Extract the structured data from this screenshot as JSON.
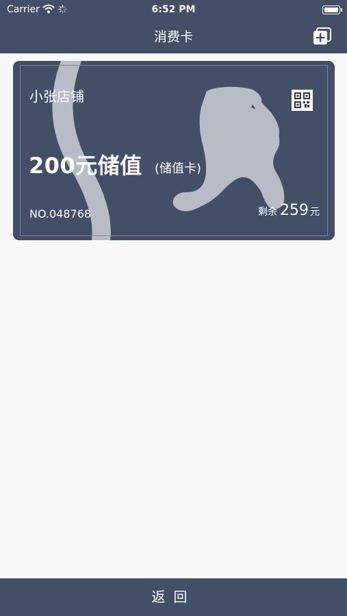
{
  "status_bar": {
    "carrier": "Carrier",
    "time": "6:52 PM"
  },
  "nav": {
    "title": "消费卡",
    "add_icon": "add-card-icon"
  },
  "card": {
    "shop_name": "小张店铺",
    "title": "200元储值",
    "type": "(储值卡)",
    "number": "NO.048768",
    "balance_label": "剩余",
    "balance_value": "259",
    "balance_unit": "元",
    "qr_icon": "qr-code-icon",
    "colors": {
      "background": "#434e67",
      "art": "#b8bcc6"
    }
  },
  "bottom": {
    "back_label": "返回"
  }
}
